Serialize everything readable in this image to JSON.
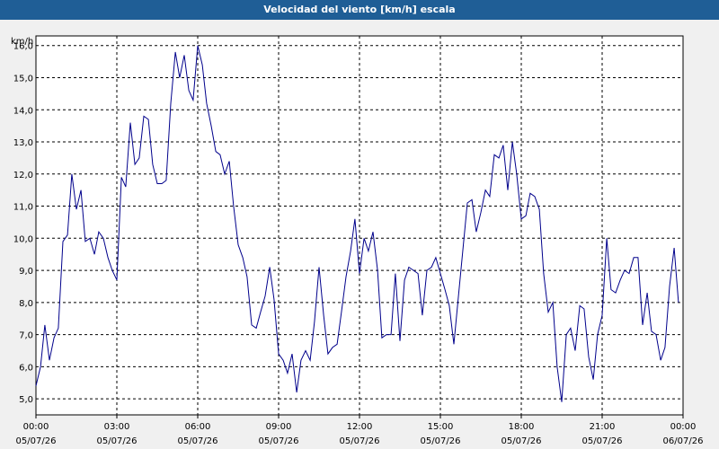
{
  "window": {
    "title": "Velocidad del viento [km/h] escala"
  },
  "chart_data": {
    "type": "line",
    "title": "Velocidad del viento [km/h] escala",
    "ylabel": "km/h",
    "ylim": [
      4.5,
      16.3
    ],
    "y_ticks": [
      "5,0",
      "6,0",
      "7,0",
      "8,0",
      "9,0",
      "10,0",
      "11,0",
      "12,0",
      "13,0",
      "14,0",
      "15,0",
      "16,0"
    ],
    "x_ticks": [
      {
        "time": "00:00",
        "date": "05/07/26"
      },
      {
        "time": "03:00",
        "date": "05/07/26"
      },
      {
        "time": "06:00",
        "date": "05/07/26"
      },
      {
        "time": "09:00",
        "date": "05/07/26"
      },
      {
        "time": "12:00",
        "date": "05/07/26"
      },
      {
        "time": "15:00",
        "date": "05/07/26"
      },
      {
        "time": "18:00",
        "date": "05/07/26"
      },
      {
        "time": "21:00",
        "date": "05/07/26"
      },
      {
        "time": "00:00",
        "date": "06/07/26"
      }
    ],
    "grid": true,
    "line_color": "#00008b",
    "series": [
      {
        "hours": [
          0,
          0.17,
          0.33,
          0.5,
          0.67,
          0.83,
          1,
          1.17,
          1.33,
          1.5,
          1.67,
          1.83,
          2,
          2.17,
          2.33,
          2.5,
          2.67,
          2.83,
          3,
          3.17,
          3.33,
          3.5,
          3.67,
          3.83,
          4,
          4.17,
          4.33,
          4.5,
          4.67,
          4.83,
          5,
          5.17,
          5.33,
          5.5,
          5.67,
          5.83,
          6,
          6.17,
          6.33,
          6.5,
          6.67,
          6.83,
          7,
          7.17,
          7.33,
          7.5,
          7.67,
          7.83,
          8,
          8.17,
          8.33,
          8.5,
          8.67,
          8.83,
          9,
          9.17,
          9.33,
          9.5,
          9.67,
          9.83,
          10,
          10.17,
          10.33,
          10.5,
          10.67,
          10.83,
          11,
          11.17,
          11.33,
          11.5,
          11.67,
          11.83,
          12,
          12.17,
          12.33,
          12.5,
          12.67,
          12.83,
          13,
          13.17,
          13.33,
          13.5,
          13.67,
          13.83,
          14,
          14.17,
          14.33,
          14.5,
          14.67,
          14.83,
          15,
          15.17,
          15.33,
          15.5,
          15.67,
          15.83,
          16,
          16.17,
          16.33,
          16.5,
          16.67,
          16.83,
          17,
          17.17,
          17.33,
          17.5,
          17.67,
          17.83,
          18,
          18.17,
          18.33,
          18.5,
          18.67,
          18.83,
          19,
          19.17,
          19.33,
          19.5,
          19.67,
          19.83,
          20,
          20.17,
          20.33,
          20.5,
          20.67,
          20.83,
          21,
          21.17,
          21.33,
          21.5,
          21.67,
          21.83,
          22,
          22.17,
          22.33,
          22.5,
          22.67,
          22.83,
          23,
          23.17,
          23.33,
          23.5,
          23.67,
          23.83,
          24
        ],
        "values": [
          5.4,
          6.0,
          7.3,
          6.2,
          6.9,
          7.2,
          9.9,
          10.1,
          12.0,
          10.9,
          11.5,
          9.9,
          10.0,
          9.5,
          10.2,
          10.0,
          9.4,
          9.0,
          8.7,
          11.9,
          11.6,
          13.6,
          12.3,
          12.5,
          13.8,
          13.7,
          12.3,
          11.7,
          11.7,
          11.8,
          14.2,
          15.8,
          15.0,
          15.7,
          14.6,
          14.3,
          16.0,
          15.4,
          14.2,
          13.5,
          12.7,
          12.6,
          12.0,
          12.4,
          11.0,
          9.8,
          9.4,
          8.8,
          7.3,
          7.2,
          7.7,
          8.2,
          9.1,
          8.1,
          6.4,
          6.2,
          5.8,
          6.4,
          5.2,
          6.2,
          6.5,
          6.2,
          7.4,
          9.1,
          7.6,
          6.4,
          6.6,
          6.7,
          7.7,
          8.8,
          9.6,
          10.6,
          8.9,
          10.0,
          9.6,
          10.2,
          9.0,
          6.9,
          7.0,
          7.0,
          8.9,
          6.8,
          8.7,
          9.1,
          9.0,
          8.9,
          7.6,
          9.0,
          9.1,
          9.4,
          8.9,
          8.4,
          7.9,
          6.7,
          8.2,
          9.6,
          11.1,
          11.2,
          10.2,
          10.8,
          11.5,
          11.3,
          12.6,
          12.5,
          12.9,
          11.5,
          13.0,
          12.0,
          10.6,
          10.7,
          11.4,
          11.3,
          10.9,
          8.9,
          7.7,
          8.0,
          6.0,
          4.9,
          7.0,
          7.2,
          6.5,
          7.9,
          7.8,
          6.3,
          5.6,
          7.0,
          7.6,
          10.0,
          8.4,
          8.3,
          8.7,
          9.0,
          8.9,
          9.4,
          9.4,
          7.3,
          8.3,
          7.1,
          7.0,
          6.2,
          6.6,
          8.5,
          9.7,
          8.0
        ]
      }
    ]
  }
}
